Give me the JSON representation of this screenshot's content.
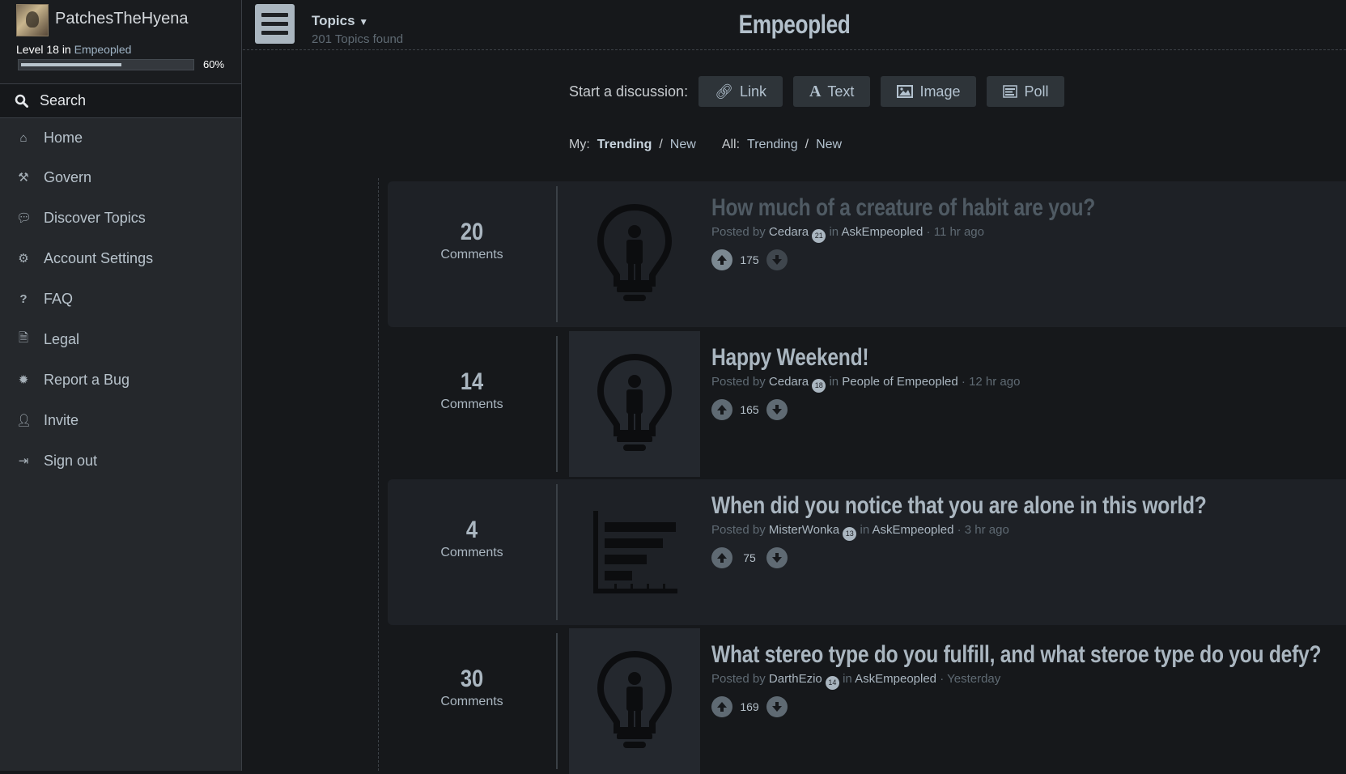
{
  "profile": {
    "username": "PatchesTheHyena",
    "level_text": "Level 18 in",
    "level_community": "Empeopled",
    "xp_percent": 60,
    "xp_label": "60%"
  },
  "sidebar": {
    "search_label": "Search",
    "items": [
      {
        "label": "Home",
        "icon": "home-icon"
      },
      {
        "label": "Govern",
        "icon": "gavel-icon"
      },
      {
        "label": "Discover Topics",
        "icon": "chat-bubbles-icon"
      },
      {
        "label": "Account Settings",
        "icon": "gear-icon"
      },
      {
        "label": "FAQ",
        "icon": "question-icon"
      },
      {
        "label": "Legal",
        "icon": "document-icon"
      },
      {
        "label": "Report a Bug",
        "icon": "bug-icon"
      },
      {
        "label": "Invite",
        "icon": "user-icon"
      },
      {
        "label": "Sign out",
        "icon": "sign-out-icon"
      }
    ]
  },
  "header": {
    "topics_label": "Topics",
    "topics_count": "201 Topics found",
    "site_title": "Empeopled"
  },
  "discussion": {
    "start_label": "Start a discussion:",
    "buttons": [
      {
        "label": "Link",
        "icon": "link-icon"
      },
      {
        "label": "Text",
        "icon": "text-icon"
      },
      {
        "label": "Image",
        "icon": "image-icon"
      },
      {
        "label": "Poll",
        "icon": "poll-icon"
      }
    ]
  },
  "filters": {
    "my_label": "My:",
    "my_trending": "Trending",
    "my_new": "New",
    "all_label": "All:",
    "all_trending": "Trending",
    "all_new": "New",
    "separator": "/"
  },
  "topics": [
    {
      "comments": "20",
      "comments_label": "Comments",
      "title": "How much of a creature of habit are you?",
      "posted_by": "Posted by",
      "user": "Cedara",
      "user_level": "21",
      "in": "in",
      "community": "AskEmpeopled",
      "time": "· 11 hr ago",
      "score": "175",
      "thumb": "lightbulb-icon"
    },
    {
      "comments": "14",
      "comments_label": "Comments",
      "title": "Happy Weekend!",
      "posted_by": "Posted by",
      "user": "Cedara",
      "user_level": "18",
      "in": "in",
      "community": "People of Empeopled",
      "time": "· 12 hr ago",
      "score": "165",
      "thumb": "lightbulb-icon"
    },
    {
      "comments": "4",
      "comments_label": "Comments",
      "title": "When did you notice that you are alone in this world?",
      "posted_by": "Posted by",
      "user": "MisterWonka",
      "user_level": "13",
      "in": "in",
      "community": "AskEmpeopled",
      "time": "· 3 hr ago",
      "score": "75",
      "thumb": "bar-chart-icon"
    },
    {
      "comments": "30",
      "comments_label": "Comments",
      "title": "What stereo type do you fulfill, and what steroe type do you defy?",
      "posted_by": "Posted by",
      "user": "DarthEzio",
      "user_level": "14",
      "in": "in",
      "community": "AskEmpeopled",
      "time": "· Yesterday",
      "score": "169",
      "thumb": "lightbulb-icon"
    }
  ]
}
